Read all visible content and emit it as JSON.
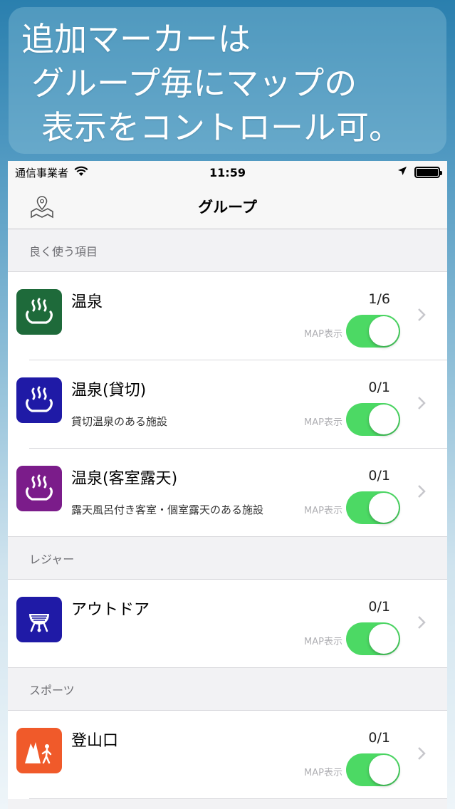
{
  "banner": {
    "line1": "追加マーカーは",
    "line2": "グループ毎にマップの",
    "line3": "表示をコントロール可。"
  },
  "status": {
    "carrier": "通信事業者",
    "time": "11:59"
  },
  "nav": {
    "title": "グループ",
    "map_icon": "map-pin-icon"
  },
  "sections": [
    {
      "header": "良く使う項目",
      "rows": [
        {
          "name": "温泉",
          "desc": "",
          "count": "1/6",
          "map_label": "MAP表示",
          "icon": "hot-spring-icon",
          "icon_color": "#1e6a3a",
          "map_visible": true
        },
        {
          "name": "温泉(貸切)",
          "desc": "貸切温泉のある施設",
          "count": "0/1",
          "map_label": "MAP表示",
          "icon": "hot-spring-icon",
          "icon_color": "#1f1aa6",
          "map_visible": true
        },
        {
          "name": "温泉(客室露天)",
          "desc": "露天風呂付き客室・個室露天のある施設",
          "count": "0/1",
          "map_label": "MAP表示",
          "icon": "hot-spring-icon",
          "icon_color": "#7b1c8a",
          "map_visible": true
        }
      ]
    },
    {
      "header": "レジャー",
      "rows": [
        {
          "name": "アウトドア",
          "desc": "",
          "count": "0/1",
          "map_label": "MAP表示",
          "icon": "bbq-grill-icon",
          "icon_color": "#1f1aa6",
          "map_visible": true
        }
      ]
    },
    {
      "header": "スポーツ",
      "rows": [
        {
          "name": "登山口",
          "desc": "",
          "count": "0/1",
          "map_label": "MAP表示",
          "icon": "mountain-hiker-icon",
          "icon_color": "#f05a2a",
          "map_visible": true
        }
      ]
    }
  ],
  "colors": {
    "toggle_on": "#4cd964",
    "section_bg": "#f2f2f4"
  }
}
